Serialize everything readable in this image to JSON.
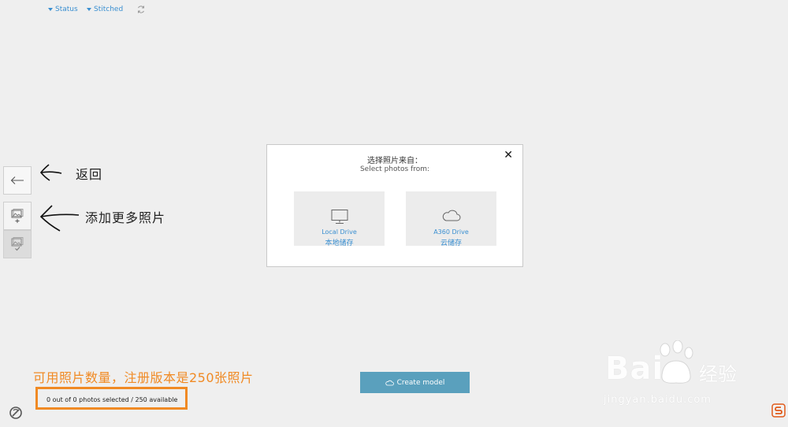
{
  "filters": {
    "status_label": "Status",
    "stitched_label": "Stitched"
  },
  "annotations": {
    "back_label": "返回",
    "add_more_label": "添加更多照片",
    "count_note": "可用照片数量，注册版本是250张照片"
  },
  "dialog": {
    "title_cn": "选择照片来自：",
    "title_en": "Select photos from:",
    "close_symbol": "✕",
    "sources": [
      {
        "name": "Local Drive",
        "name_cn": "本地储存",
        "icon": "monitor-icon"
      },
      {
        "name": "A360 Drive",
        "name_cn": "云储存",
        "icon": "cloud-icon"
      }
    ]
  },
  "footer": {
    "photo_count": "0 out of 0 photos selected / 250 available",
    "create_model_label": "Create model"
  },
  "watermark": {
    "brand": "Bai",
    "brand_cn": "经验",
    "url": "jingyan.baidu.com"
  },
  "colors": {
    "accent_blue": "#3a8fd1",
    "button_teal": "#5aa0bd",
    "annotation_orange": "#f08a24",
    "background": "#efefef"
  }
}
